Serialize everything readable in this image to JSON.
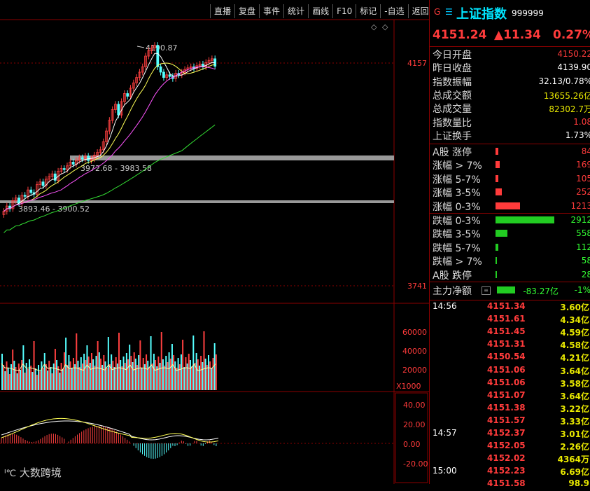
{
  "toolbar": [
    "直播",
    "复盘",
    "事件",
    "统计",
    "画线",
    "F10",
    "标记",
    "-自选",
    "返回"
  ],
  "header": {
    "market_flag": "G",
    "menu_glyph": "☰",
    "name": "上证指数",
    "code": "999999",
    "price": "4151.24",
    "change": "▲11.34",
    "pct": "0.27%"
  },
  "stats": [
    {
      "label": "今日开盘",
      "value": "4150.22",
      "color": "red"
    },
    {
      "label": "昨日收盘",
      "value": "4139.90",
      "color": "white"
    },
    {
      "label": "指数振幅",
      "value": "32.13/0.78%",
      "color": "white"
    },
    {
      "label": "总成交额",
      "value": "13655.26亿",
      "color": "yellow"
    },
    {
      "label": "总成交量",
      "value": "82302.7万",
      "color": "yellow"
    },
    {
      "label": "指数量比",
      "value": "1.08",
      "color": "red"
    },
    {
      "label": "上证换手",
      "value": "1.73%",
      "color": "white"
    }
  ],
  "breadth_up": [
    {
      "label": "A股 涨停",
      "value": "84",
      "bar": 4
    },
    {
      "label": "涨幅 > 7%",
      "value": "169",
      "bar": 6
    },
    {
      "label": "涨幅 5-7%",
      "value": "105",
      "bar": 4
    },
    {
      "label": "涨幅 3-5%",
      "value": "252",
      "bar": 9
    },
    {
      "label": "涨幅 0-3%",
      "value": "1213",
      "bar": 35
    }
  ],
  "breadth_down": [
    {
      "label": "跌幅 0-3%",
      "value": "2912",
      "bar": 84
    },
    {
      "label": "跌幅 3-5%",
      "value": "558",
      "bar": 17
    },
    {
      "label": "跌幅 5-7%",
      "value": "112",
      "bar": 4
    },
    {
      "label": "跌幅 > 7%",
      "value": "58",
      "bar": 1
    },
    {
      "label": "A股 跌停",
      "value": "28",
      "bar": 1
    }
  ],
  "main_flow": {
    "label": "主力净额",
    "value": "-83.27亿",
    "pct": "-1%"
  },
  "ticks": [
    {
      "time": "14:56",
      "price": "4151.34",
      "amount": "3.60亿"
    },
    {
      "time": "",
      "price": "4151.61",
      "amount": "4.34亿"
    },
    {
      "time": "",
      "price": "4151.45",
      "amount": "4.59亿"
    },
    {
      "time": "",
      "price": "4151.31",
      "amount": "4.58亿"
    },
    {
      "time": "",
      "price": "4150.54",
      "amount": "4.21亿"
    },
    {
      "time": "",
      "price": "4151.06",
      "amount": "3.64亿"
    },
    {
      "time": "",
      "price": "4151.06",
      "amount": "3.58亿"
    },
    {
      "time": "",
      "price": "4151.07",
      "amount": "3.64亿"
    },
    {
      "time": "",
      "price": "4151.38",
      "amount": "3.22亿"
    },
    {
      "time": "",
      "price": "4151.57",
      "amount": "3.33亿"
    },
    {
      "time": "14:57",
      "price": "4152.37",
      "amount": "3.01亿"
    },
    {
      "time": "",
      "price": "4152.05",
      "amount": "2.26亿"
    },
    {
      "time": "",
      "price": "4152.02",
      "amount": "4364万"
    },
    {
      "time": "15:00",
      "price": "4152.23",
      "amount": "6.69亿"
    },
    {
      "time": "",
      "price": "4151.58",
      "amount": "98.9"
    }
  ],
  "chart_labels": {
    "high": "4190.87",
    "zone1": "3972.68 - 3983.58",
    "zone2": "3893.46 - 3900.52",
    "axis_price": [
      "4157",
      "3741"
    ],
    "axis_vol": [
      "60000",
      "40000",
      "20000"
    ],
    "vol_unit": "X1000",
    "axis_macd": [
      "40.00",
      "20.00",
      "0.00",
      "-20.00"
    ]
  },
  "watermark": "大数跨境",
  "chart_data": {
    "type": "candlestick",
    "price_axis": {
      "ticks": [
        4157,
        3741
      ]
    },
    "candles_close": [
      3880,
      3890,
      3885,
      3900,
      3905,
      3895,
      3910,
      3908,
      3920,
      3915,
      3912,
      3930,
      3935,
      3928,
      3940,
      3945,
      3950,
      3938,
      3955,
      3960,
      3958,
      3965,
      3972,
      3968,
      3975,
      3980,
      3978,
      3983,
      3975,
      3978,
      3985,
      3990,
      3995,
      4010,
      4030,
      4050,
      4070,
      4080,
      4060,
      4085,
      4100,
      4095,
      4110,
      4120,
      4130,
      4140,
      4150,
      4170,
      4180,
      4185,
      4190,
      4150,
      4140,
      4130,
      4135,
      4132,
      4128,
      4138,
      4135,
      4140,
      4145,
      4148,
      4150,
      4147,
      4152,
      4155,
      4150,
      4158,
      4162,
      4165,
      4151
    ],
    "volume_axis": {
      "ticks": [
        60000,
        40000,
        20000
      ],
      "unit": "X1000"
    },
    "macd_axis": {
      "ticks": [
        40,
        20,
        0,
        -20
      ]
    }
  }
}
